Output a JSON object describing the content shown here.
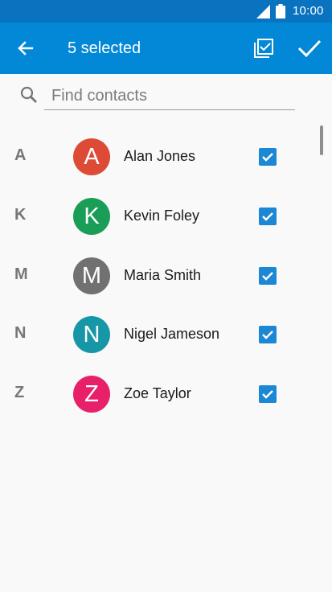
{
  "status_bar": {
    "time": "10:00"
  },
  "app_bar": {
    "title": "5 selected"
  },
  "search": {
    "placeholder": "Find contacts",
    "value": ""
  },
  "contacts": [
    {
      "section": "A",
      "initial": "A",
      "name": "Alan Jones",
      "color": "#dd4a35",
      "checked": true
    },
    {
      "section": "K",
      "initial": "K",
      "name": "Kevin Foley",
      "color": "#1a9e57",
      "checked": true
    },
    {
      "section": "M",
      "initial": "M",
      "name": "Maria Smith",
      "color": "#717171",
      "checked": true
    },
    {
      "section": "N",
      "initial": "N",
      "name": "Nigel Jameson",
      "color": "#1797a6",
      "checked": true
    },
    {
      "section": "Z",
      "initial": "Z",
      "name": "Zoe Taylor",
      "color": "#e8206a",
      "checked": true
    }
  ],
  "icons": {
    "back": "back-arrow-icon",
    "select_all": "select-all-icon",
    "confirm": "checkmark-icon",
    "search": "search-icon",
    "signal": "signal-icon",
    "battery": "battery-icon"
  },
  "colors": {
    "status_bar": "#0a73c0",
    "app_bar": "#0288d6",
    "checkbox": "#1c87d4"
  }
}
